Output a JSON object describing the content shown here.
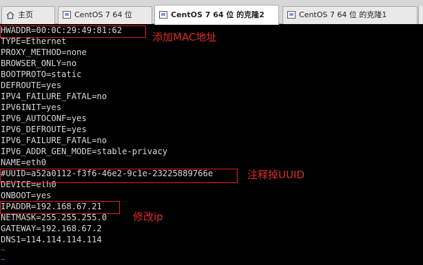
{
  "tabs": [
    {
      "label": "主页",
      "icon": "home-icon",
      "active": false
    },
    {
      "label": "CentOS 7 64 位",
      "icon": "vm-icon",
      "active": false
    },
    {
      "label": "CentOS 7 64 位 的克隆2",
      "icon": "vm-icon",
      "active": true
    },
    {
      "label": "CentOS 7 64 位 的克隆1",
      "icon": "vm-icon",
      "active": false
    }
  ],
  "terminal": {
    "lines": [
      "HWADDR=00:0C:29:49:81:62",
      "TYPE=Ethernet",
      "PROXY_METHOD=none",
      "BROWSER_ONLY=no",
      "BOOTPROTO=static",
      "DEFROUTE=yes",
      "IPV4_FAILURE_FATAL=no",
      "IPV6INIT=yes",
      "IPV6_AUTOCONF=yes",
      "IPV6_DEFROUTE=yes",
      "IPV6_FAILURE_FATAL=no",
      "IPV6_ADDR_GEN_MODE=stable-privacy",
      "NAME=eth0",
      "#UUID=a52a0112-f3f6-46e2-9c1e-23225889766e",
      "DEVICE=eth0",
      "ONBOOT=yes",
      "IPADDR=192.168.67.21",
      "NETMASK=255.255.255.0",
      "GATEWAY=192.168.67.2",
      "DNS1=114.114.114.114",
      "~",
      "~"
    ]
  },
  "annotations": {
    "mac": "添加MAC地址",
    "uuid": "注释掉UUID",
    "ip": "修改ip"
  },
  "colors": {
    "annotation": "#e02020",
    "terminal_text": "#d9d9d9",
    "terminal_bg": "#000000",
    "tilde": "#3b6bd6"
  }
}
